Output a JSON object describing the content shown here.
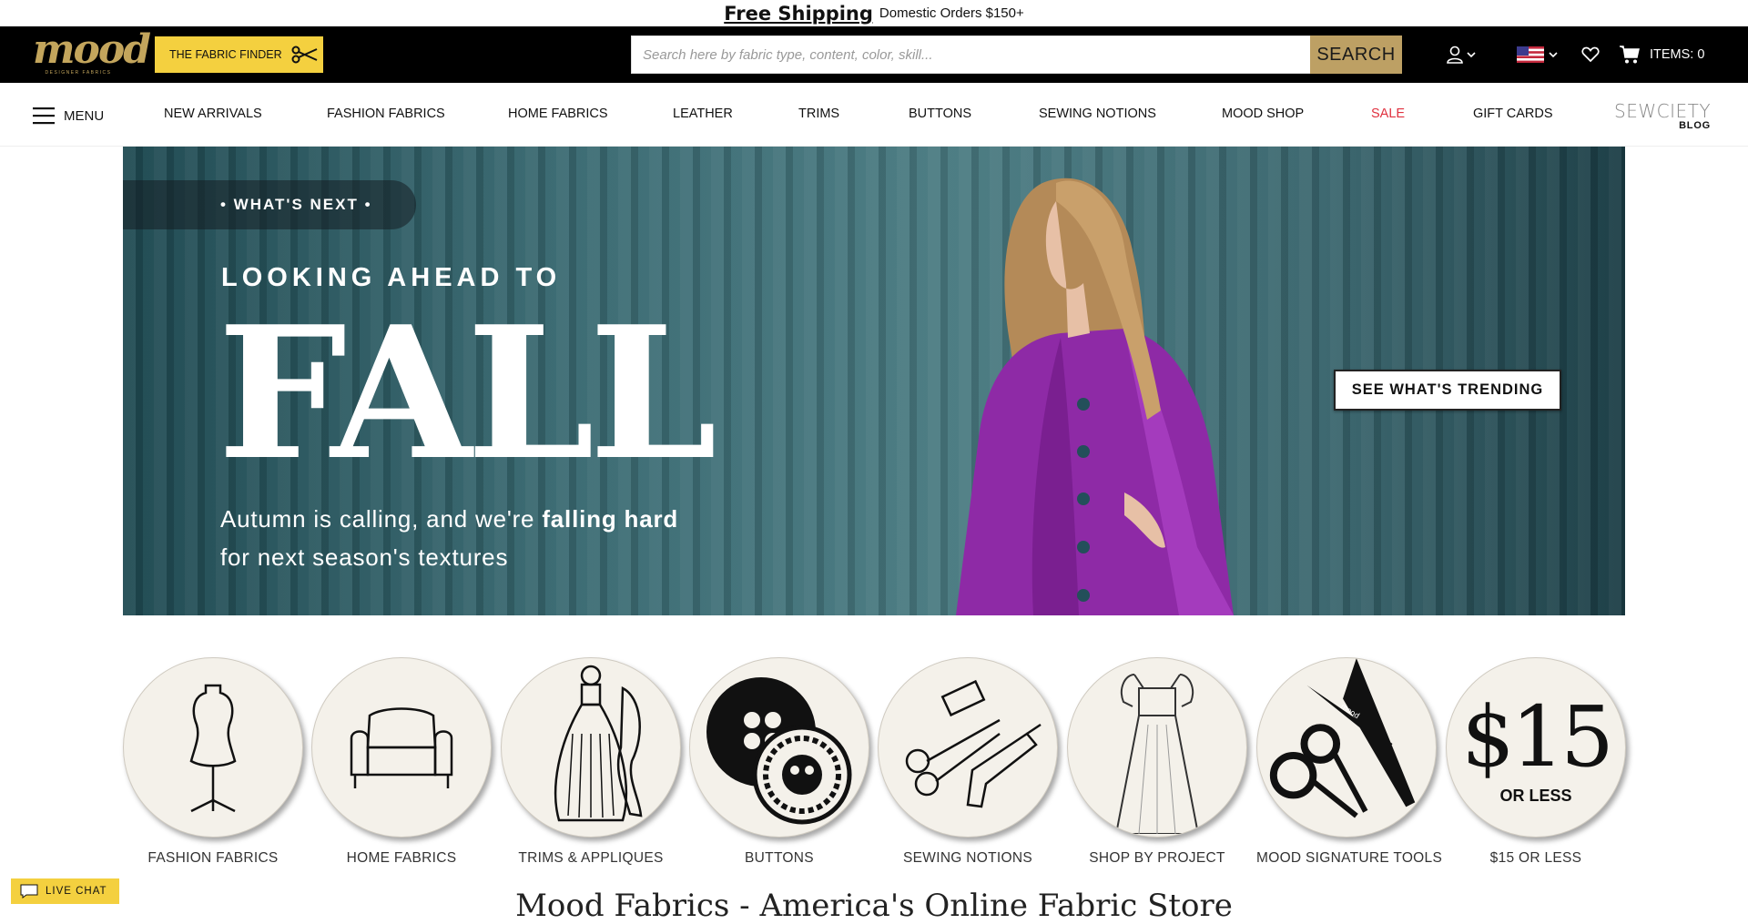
{
  "promo": {
    "headline": "Free Shipping",
    "detail": "Domestic Orders $150+"
  },
  "header": {
    "logo_text": "mood",
    "logo_tagline": "DESIGNER FABRICS",
    "fabric_finder_label": "THE FABRIC FINDER",
    "search": {
      "placeholder": "Search here by fabric type, content, color, skill...",
      "value": "",
      "button_label": "SEARCH"
    },
    "cart_label": "ITEMS: 0"
  },
  "nav": {
    "menu_label": "MENU",
    "items": [
      "NEW ARRIVALS",
      "FASHION FABRICS",
      "HOME FABRICS",
      "LEATHER",
      "TRIMS",
      "BUTTONS",
      "SEWING NOTIONS",
      "MOOD SHOP",
      "SALE",
      "GIFT CARDS"
    ],
    "blog_title": "SEWCIETY",
    "blog_label": "BLOG"
  },
  "hero": {
    "eyebrow": "• WHAT'S NEXT •",
    "pretitle": "LOOKING AHEAD TO",
    "title": "FALL",
    "subtitle_parts": [
      "Autumn is calling, and we're ",
      "falling hard",
      " for next season's textures"
    ],
    "cta_label": "SEE WHAT'S TRENDING"
  },
  "categories": [
    {
      "label": "FASHION FABRICS",
      "icon": "dress-form-icon"
    },
    {
      "label": "HOME FABRICS",
      "icon": "armchair-icon"
    },
    {
      "label": "TRIMS & APPLIQUES",
      "icon": "tassel-icon"
    },
    {
      "label": "BUTTONS",
      "icon": "buttons-icon"
    },
    {
      "label": "SEWING NOTIONS",
      "icon": "sewing-tools-icon"
    },
    {
      "label": "SHOP BY PROJECT",
      "icon": "dress-sketch-icon"
    },
    {
      "label": "MOOD SIGNATURE TOOLS",
      "icon": "scissors-icon"
    },
    {
      "label": "$15 OR LESS",
      "icon": "price-icon"
    }
  ],
  "price_badge": {
    "amount": "$15",
    "caption": "OR LESS"
  },
  "scissors_brand": "mood",
  "bottom_heading": "Mood Fabrics - America's Online Fabric Store",
  "live_chat_label": "LIVE CHAT",
  "colors": {
    "header_bg": "#000000",
    "finder_bg": "#f4d03f",
    "search_button": "#bda064",
    "logo": "#c3a55c",
    "sale": "#e0313f",
    "hero_coat": "#8e2aa6"
  }
}
